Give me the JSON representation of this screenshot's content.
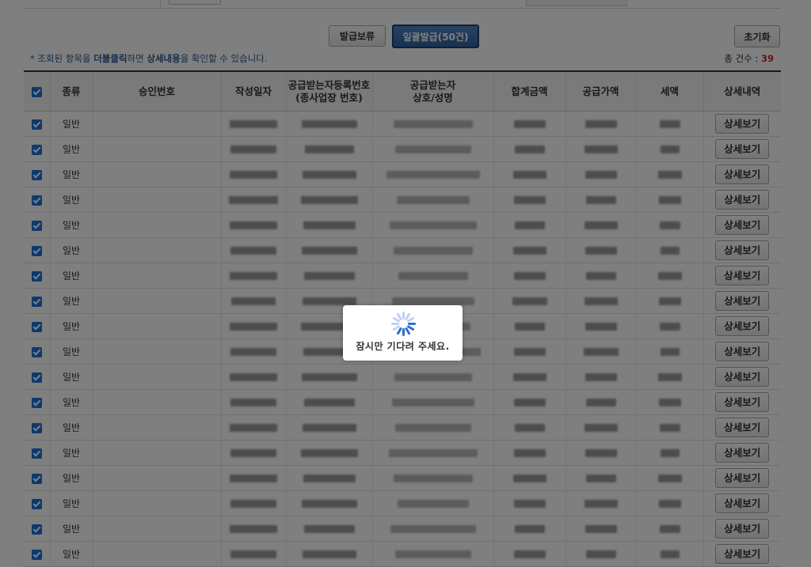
{
  "toolbar": {
    "hold_label": "발급보류",
    "bulk_issue_label": "일괄발급(50건)",
    "reset_label": "초기화"
  },
  "hint": {
    "prefix": "* 조회된 항목을 ",
    "double_click": "더블클릭",
    "middle": "하면 ",
    "detail_content": "상세내용",
    "suffix": "을 확인할 수 있습니다."
  },
  "total": {
    "label": "총 건수 : ",
    "count": "39"
  },
  "table": {
    "headers": {
      "type": "종류",
      "approval_no": "승인번호",
      "date": "작성일자",
      "reg_no_line1": "공급받는자등록번호",
      "reg_no_line2": "(종사업장 번호)",
      "buyer_line1": "공급받는자",
      "buyer_line2": "상호/성명",
      "total_amount": "합계금액",
      "supply_value": "공급가액",
      "tax": "세액",
      "details": "상세내역"
    },
    "rows": [
      {
        "type": "일반",
        "detail_button": "상세보기",
        "checked": true
      },
      {
        "type": "일반",
        "detail_button": "상세보기",
        "checked": true
      },
      {
        "type": "일반",
        "detail_button": "상세보기",
        "checked": true
      },
      {
        "type": "일반",
        "detail_button": "상세보기",
        "checked": true
      },
      {
        "type": "일반",
        "detail_button": "상세보기",
        "checked": true
      },
      {
        "type": "일반",
        "detail_button": "상세보기",
        "checked": true
      },
      {
        "type": "일반",
        "detail_button": "상세보기",
        "checked": true
      },
      {
        "type": "일반",
        "detail_button": "상세보기",
        "checked": true
      },
      {
        "type": "일반",
        "detail_button": "상세보기",
        "checked": true
      },
      {
        "type": "일반",
        "detail_button": "상세보기",
        "checked": true
      },
      {
        "type": "일반",
        "detail_button": "상세보기",
        "checked": true
      },
      {
        "type": "일반",
        "detail_button": "상세보기",
        "checked": true
      },
      {
        "type": "일반",
        "detail_button": "상세보기",
        "checked": true
      },
      {
        "type": "일반",
        "detail_button": "상세보기",
        "checked": true
      },
      {
        "type": "일반",
        "detail_button": "상세보기",
        "checked": true
      },
      {
        "type": "일반",
        "detail_button": "상세보기",
        "checked": true
      },
      {
        "type": "일반",
        "detail_button": "상세보기",
        "checked": true
      },
      {
        "type": "일반",
        "detail_button": "상세보기",
        "checked": true
      }
    ]
  },
  "loading": {
    "message": "잠시만 기다려 주세요."
  },
  "colors": {
    "accent": "#2f62a3",
    "checkbox": "#1d72d8",
    "count": "#c0282a",
    "overlay": "rgba(0,0,0,0.5)"
  }
}
